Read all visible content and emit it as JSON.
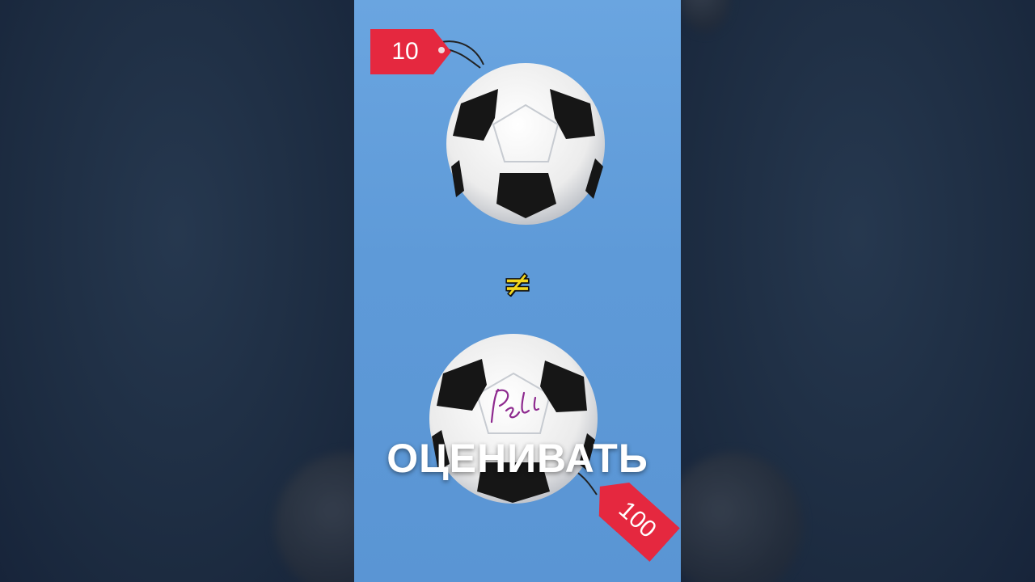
{
  "video": {
    "price_tag_top": "10",
    "price_tag_bottom": "100",
    "not_equal_symbol": "≠",
    "caption": "ОЦЕНИВАТЬ",
    "signature": "Pelé"
  },
  "colors": {
    "background_blue": "#5e9ad8",
    "tag_red": "#e5283f",
    "neq_yellow": "#f2d61c",
    "side_dark": "#1f2f45"
  },
  "icons": [
    "soccer-ball-icon",
    "price-tag-icon",
    "not-equal-icon"
  ]
}
